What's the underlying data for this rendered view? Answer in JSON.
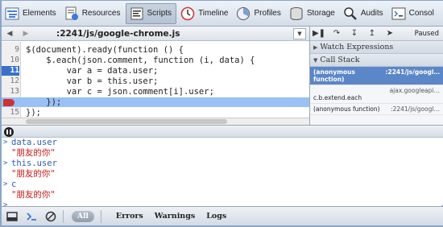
{
  "toolbar": {
    "tabs": [
      {
        "label": "Elements",
        "icon": "elements-icon"
      },
      {
        "label": "Resources",
        "icon": "resources-icon"
      },
      {
        "label": "Scripts",
        "icon": "scripts-icon",
        "active": true
      },
      {
        "label": "Timeline",
        "icon": "timeline-icon"
      },
      {
        "label": "Profiles",
        "icon": "profiles-icon"
      },
      {
        "label": "Storage",
        "icon": "storage-icon"
      },
      {
        "label": "Audits",
        "icon": "audits-icon"
      },
      {
        "label": "Consol",
        "icon": "console-icon"
      }
    ]
  },
  "source": {
    "file_path": ":2241/js/google-chrome.js",
    "lines": [
      {
        "num": "9",
        "text": "$(document).ready(function () {"
      },
      {
        "num": "10",
        "text": "    $.each(json.comment, function (i, data) {"
      },
      {
        "num": "11",
        "text": "        var a = data.user;",
        "current": true
      },
      {
        "num": "12",
        "text": "        var b = this.user;"
      },
      {
        "num": "13",
        "text": "        var c = json.comment[i].user;"
      },
      {
        "num": "14",
        "text": "    });",
        "breakpoint": true,
        "highlight": true
      },
      {
        "num": "15",
        "text": "});"
      }
    ]
  },
  "sidebar": {
    "paused_label": "Paused",
    "watch_header": "Watch Expressions",
    "callstack_header": "Call Stack",
    "frames": [
      {
        "fn": "(anonymous function)",
        "loc": ":2241/js/googl…",
        "selected": true
      },
      {
        "fn": "c.b.extend.each",
        "loc": "ajax.googleapi…"
      },
      {
        "fn": "(anonymous function)",
        "loc": ":2241/js/googl…"
      }
    ]
  },
  "console": {
    "entries": [
      {
        "cmd": "data.user",
        "result": "\"朋友的你\""
      },
      {
        "cmd": "this.user",
        "result": "\"朋友的你\""
      },
      {
        "cmd": "c",
        "result": "\"朋友的你\""
      }
    ]
  },
  "statusbar": {
    "all_label": "All",
    "filters": [
      "Errors",
      "Warnings",
      "Logs"
    ]
  }
}
